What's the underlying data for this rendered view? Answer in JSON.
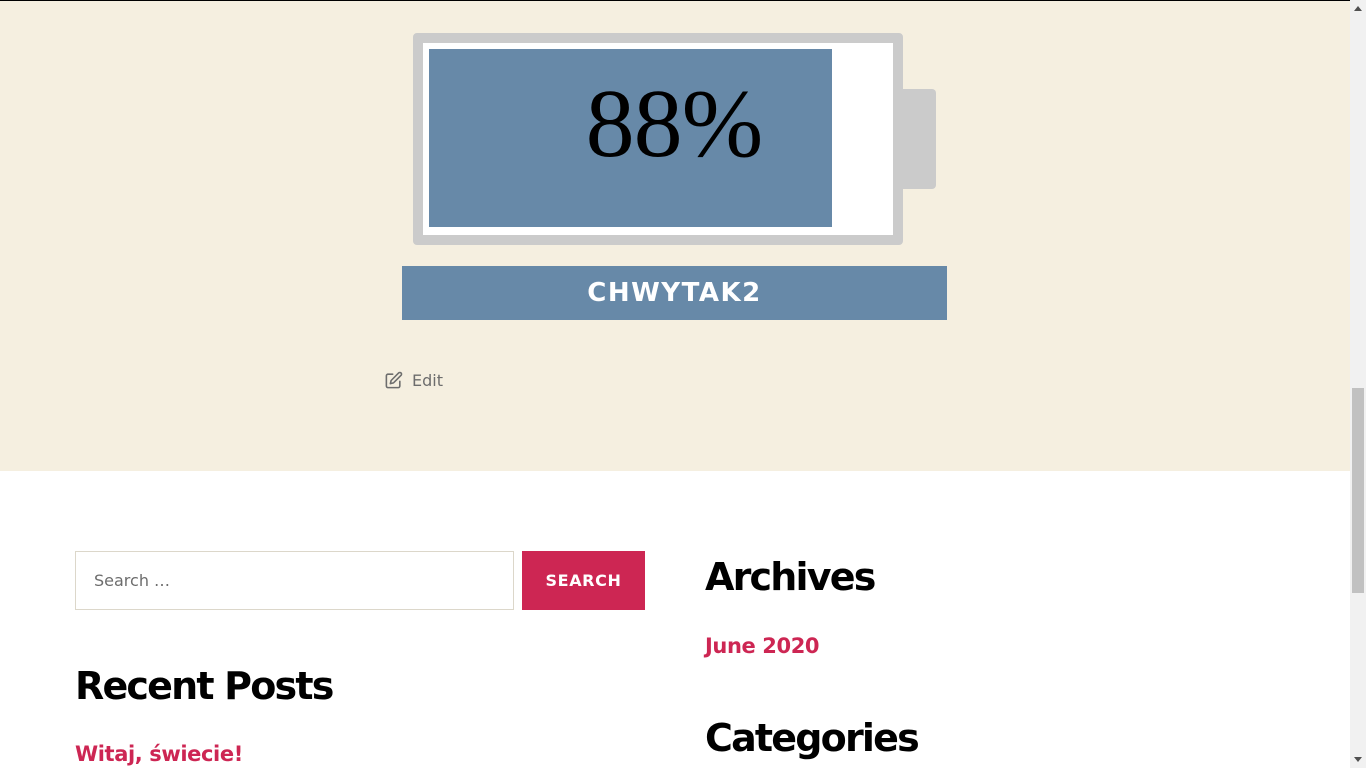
{
  "battery": {
    "level": 88,
    "percent_text": "88%",
    "fill_color": "#6789a8",
    "frame_color": "#cbcbcb"
  },
  "device": {
    "name": "CHWYTAK2"
  },
  "post": {
    "edit_label": "Edit",
    "edit_icon": "edit-icon"
  },
  "search": {
    "placeholder": "Search …",
    "value": "",
    "button_label": "SEARCH"
  },
  "recent_posts": {
    "title": "Recent Posts",
    "items": [
      "Witaj, świecie!"
    ]
  },
  "archives": {
    "title": "Archives",
    "items": [
      "June 2020"
    ]
  },
  "categories": {
    "title": "Categories"
  },
  "colors": {
    "accent": "#cd2653",
    "band_background": "#f5efe0",
    "text": "#000000"
  }
}
